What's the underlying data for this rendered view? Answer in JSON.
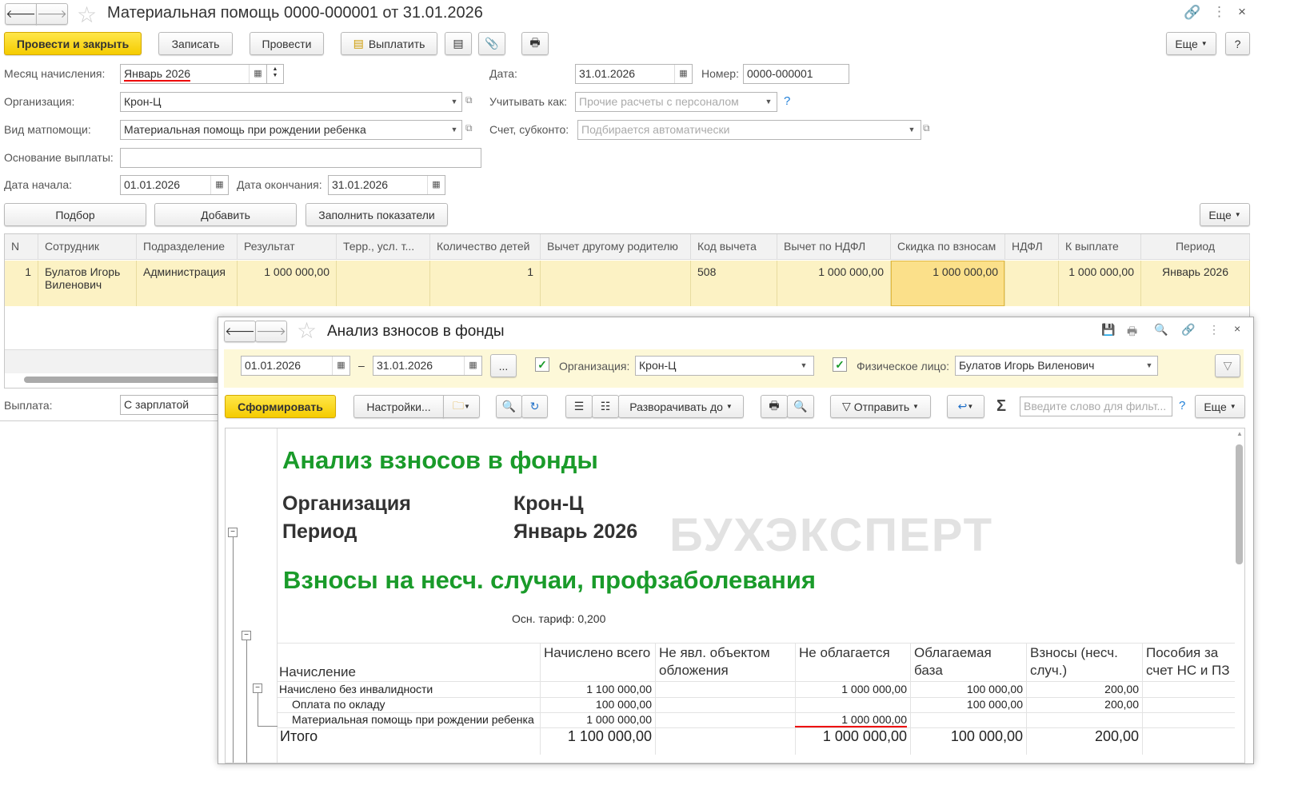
{
  "window": {
    "title": "Материальная помощь 0000-000001 от 31.01.2026"
  },
  "toolbar": {
    "post_close": "Провести и закрыть",
    "save": "Записать",
    "post": "Провести",
    "pay": "Выплатить",
    "more": "Еще",
    "help": "?"
  },
  "form": {
    "month_label": "Месяц начисления:",
    "month_value": "Январь 2026",
    "date_label": "Дата:",
    "date_value": "31.01.2026",
    "number_label": "Номер:",
    "number_value": "0000-000001",
    "org_label": "Организация:",
    "org_value": "Крон-Ц",
    "account_as_label": "Учитывать как:",
    "account_as_placeholder": "Прочие расчеты с персоналом",
    "type_label": "Вид матпомощи:",
    "type_value": "Материальная помощь при рождении ребенка",
    "subaccount_label": "Счет, субконто:",
    "subaccount_placeholder": "Подбирается автоматически",
    "basis_label": "Основание выплаты:",
    "basis_value": "",
    "start_label": "Дата начала:",
    "start_value": "01.01.2026",
    "end_label": "Дата окончания:",
    "end_value": "31.01.2026",
    "payment_label": "Выплата:",
    "payment_value": "С зарплатой"
  },
  "table_toolbar": {
    "pick": "Подбор",
    "add": "Добавить",
    "fill": "Заполнить показатели",
    "more": "Еще"
  },
  "table": {
    "columns": [
      "N",
      "Сотрудник",
      "Подразделение",
      "Результат",
      "Терр., усл. т...",
      "Количество детей",
      "Вычет другому родителю",
      "Код вычета",
      "Вычет по НДФЛ",
      "Скидка по взносам",
      "НДФЛ",
      "К выплате",
      "Период"
    ],
    "rows": [
      [
        "1",
        "Булатов Игорь Виленович",
        "Администрация",
        "1 000 000,00",
        "",
        "1",
        "",
        "508",
        "1 000 000,00",
        "1 000 000,00",
        "",
        "1 000 000,00",
        "Январь 2026"
      ]
    ]
  },
  "report_window": {
    "title": "Анализ взносов в фонды",
    "date_from": "01.01.2026",
    "dash": "–",
    "date_to": "31.01.2026",
    "dots": "...",
    "org_label": "Организация:",
    "org_value": "Крон-Ц",
    "person_label": "Физическое лицо:",
    "person_value": "Булатов Игорь Виленович",
    "generate": "Сформировать",
    "settings": "Настройки...",
    "expand": "Разворачивать до",
    "send": "Отправить",
    "sigma": "Σ",
    "search_placeholder": "Введите слово для фильт...",
    "help": "?",
    "more": "Еще"
  },
  "report": {
    "title": "Анализ взносов в фонды",
    "org_label": "Организация",
    "org_value": "Крон-Ц",
    "period_label": "Период",
    "period_value": "Январь 2026",
    "watermark": "БУХЭКСПЕРТ",
    "section": "Взносы на несч. случаи, профзаболевания",
    "tariff": "Осн. тариф: 0,200",
    "columns": [
      "Начисление",
      "Начислено всего",
      "Не явл. объектом обложения",
      "Не облагается",
      "Облагаемая база",
      "Взносы (несч. случ.)",
      "Пособия за счет НС и ПЗ"
    ],
    "rows": [
      [
        "Начислено без инвалидности",
        "1 100 000,00",
        "",
        "1 000 000,00",
        "100 000,00",
        "200,00",
        ""
      ],
      [
        "Оплата по окладу",
        "100 000,00",
        "",
        "",
        "100 000,00",
        "200,00",
        ""
      ],
      [
        "Материальная помощь при рождении ребенка",
        "1 000 000,00",
        "",
        "1 000 000,00",
        "",
        "",
        ""
      ]
    ],
    "total": [
      "Итого",
      "1 100 000,00",
      "",
      "1 000 000,00",
      "100 000,00",
      "200,00",
      ""
    ]
  }
}
